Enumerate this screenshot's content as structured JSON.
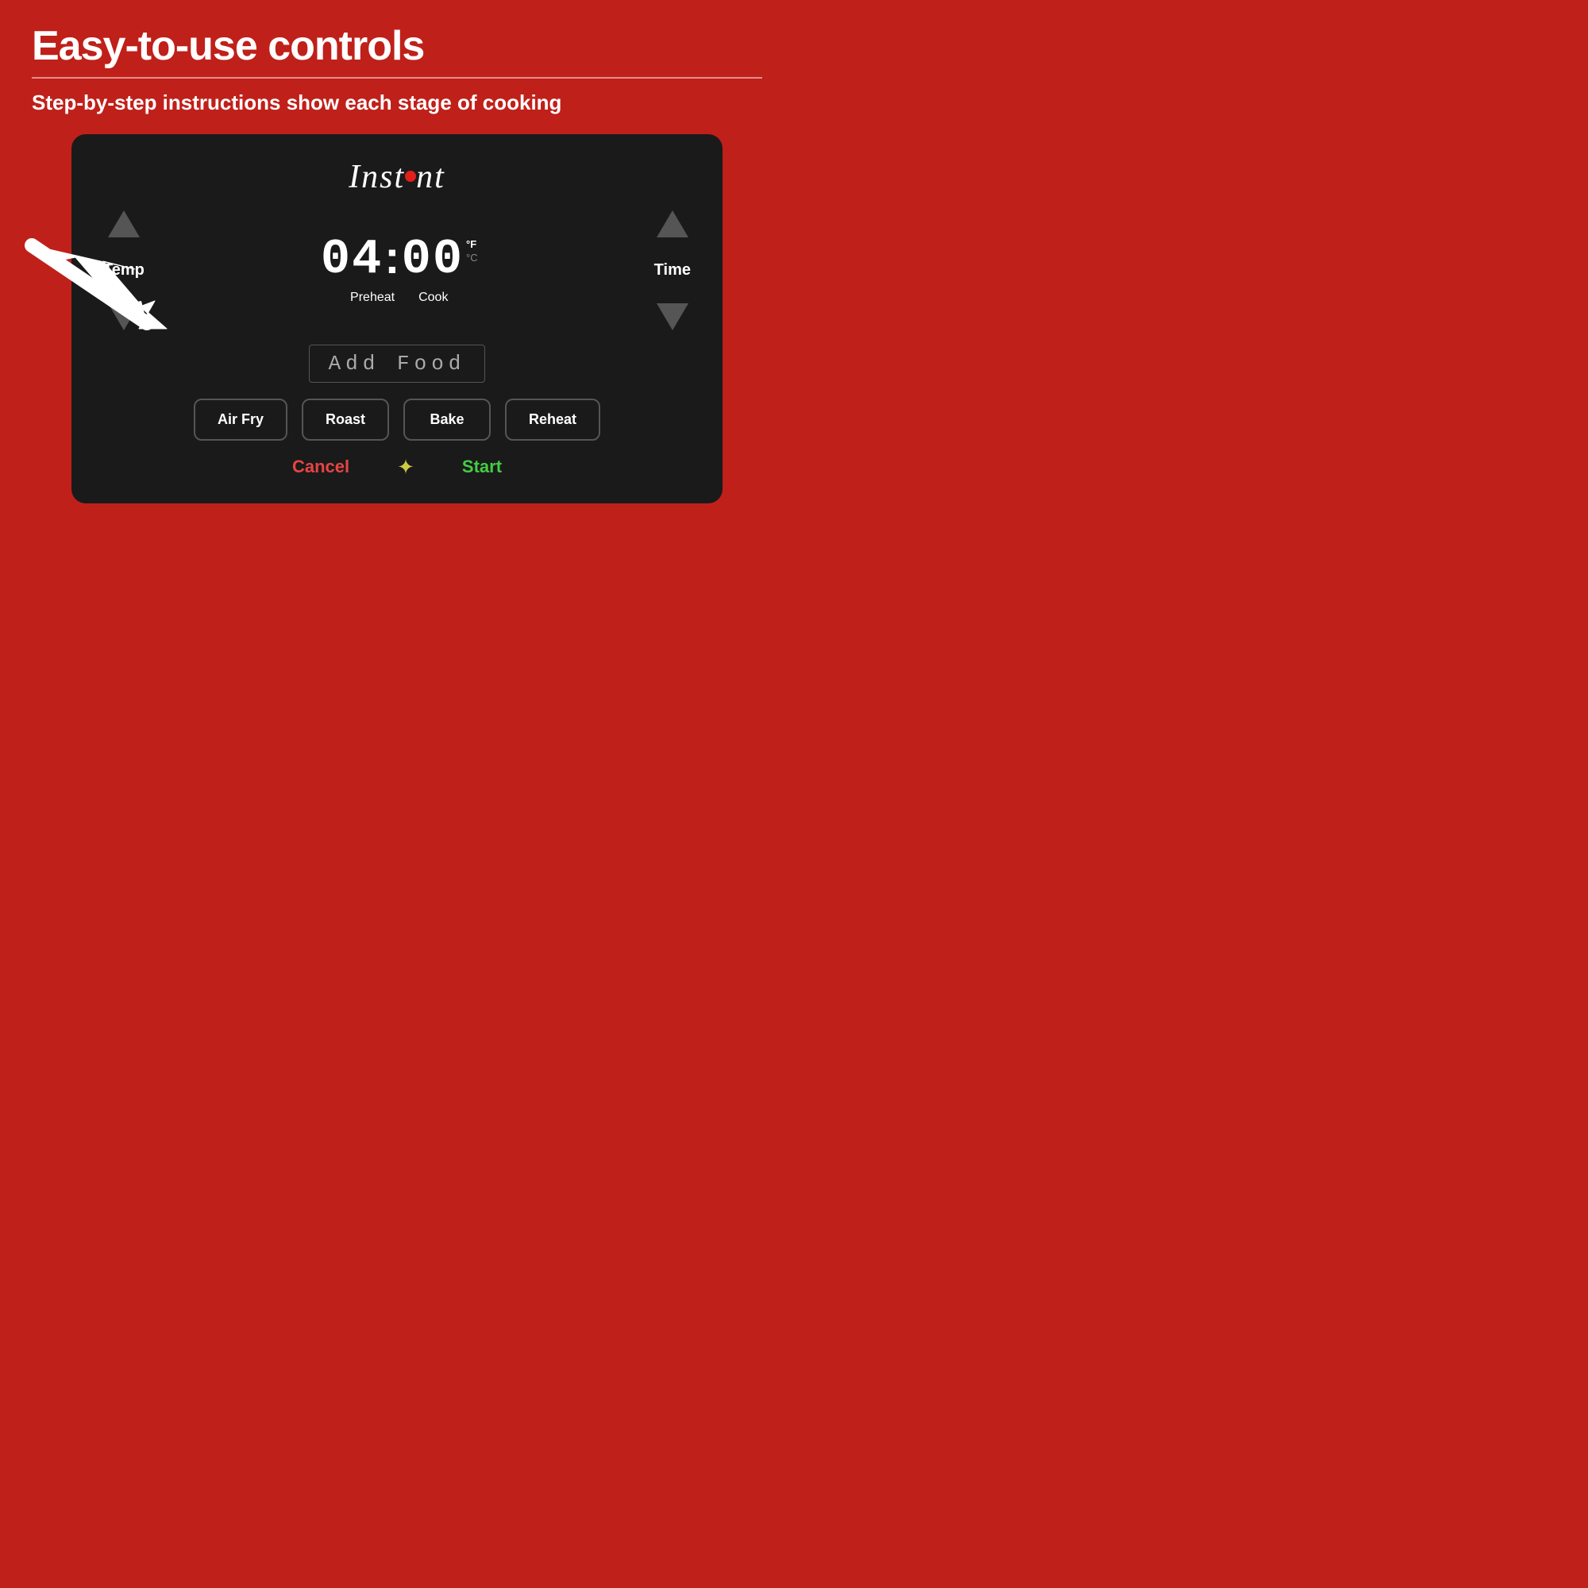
{
  "header": {
    "title": "Easy-to-use controls",
    "subtitle": "Step-by-step instructions show each stage of cooking"
  },
  "device": {
    "brand": "Instant",
    "display": {
      "time": "04:00",
      "unit_f": "°F",
      "unit_c": "°C",
      "stage_preheat": "Preheat",
      "stage_cook": "Cook",
      "add_food": "Add  Food"
    },
    "controls": {
      "temp_label": "Temp",
      "time_label": "Time"
    },
    "buttons": [
      {
        "label": "Air Fry"
      },
      {
        "label": "Roast"
      },
      {
        "label": "Bake"
      },
      {
        "label": "Reheat"
      }
    ],
    "bottom": {
      "cancel": "Cancel",
      "start": "Start"
    }
  },
  "colors": {
    "background": "#c0201a",
    "device_bg": "#1a1a1a",
    "cancel_color": "#e84444",
    "start_color": "#44cc44",
    "light_color": "#cccc44"
  }
}
